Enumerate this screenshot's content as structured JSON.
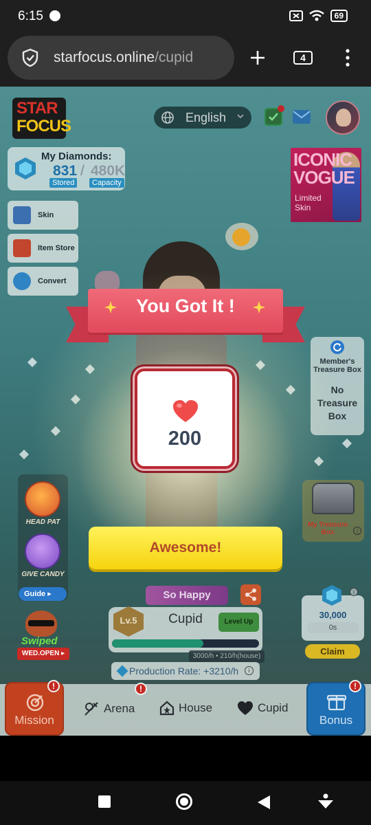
{
  "status_bar": {
    "time": "6:15",
    "battery": "69"
  },
  "browser": {
    "url_host": "starfocus.online",
    "url_path": "/cupid",
    "tab_count": "4"
  },
  "header": {
    "logo_line1": "STAR",
    "logo_line2": "FOCUS",
    "language": "English"
  },
  "diamonds": {
    "title": "My Diamonds:",
    "stored": "831",
    "separator": "/",
    "capacity": "480K",
    "stored_label": "Stored",
    "capacity_label": "Capacity"
  },
  "side_menu": [
    {
      "label": "Skin",
      "icon": "skin-icon",
      "color": "#3c6fb0"
    },
    {
      "label": "Item Store",
      "icon": "store-icon",
      "color": "#c2462e"
    },
    {
      "label": "Convert",
      "icon": "convert-icon",
      "color": "#2f84c4"
    }
  ],
  "promo": {
    "title_line1": "ICONIC",
    "title_line2": "VOGUE",
    "sub_line1": "Limited",
    "sub_line2": "Skin"
  },
  "treasure": {
    "title_line1": "Member's",
    "title_line2": "Treasure Box",
    "body_line1": "No",
    "body_line2": "Treasure",
    "body_line3": "Box"
  },
  "actions": {
    "head_pat": "HEAD PAT",
    "give_candy": "GIVE CANDY",
    "guide": "Guide ▸"
  },
  "swiped": {
    "title": "Swiped",
    "schedule": "WED.OPEN ▸"
  },
  "chest": {
    "label_line1": "My Treasure",
    "label_line2": "Box"
  },
  "production": {
    "value": "30,000",
    "time": "0s",
    "claim": "Claim"
  },
  "character": {
    "mood": "So Happy",
    "level": "Lv.5",
    "name": "Cupid",
    "level_up": "Level Up",
    "progress_fraction": 0.62,
    "progress_text": "3000/h • 210/h(house)",
    "production_rate": "Production Rate: +3210/h"
  },
  "modal": {
    "title": "You Got It !",
    "reward_value": "200",
    "button": "Awesome!"
  },
  "bottom_nav": {
    "mission": "Mission",
    "arena": "Arena",
    "house": "House",
    "cupid": "Cupid",
    "bonus": "Bonus",
    "alert": "!"
  },
  "colors": {
    "ribbon": "#e24a5c",
    "button": "#f6d40f",
    "mission": "#c2421f",
    "bonus": "#1e6fb3"
  }
}
